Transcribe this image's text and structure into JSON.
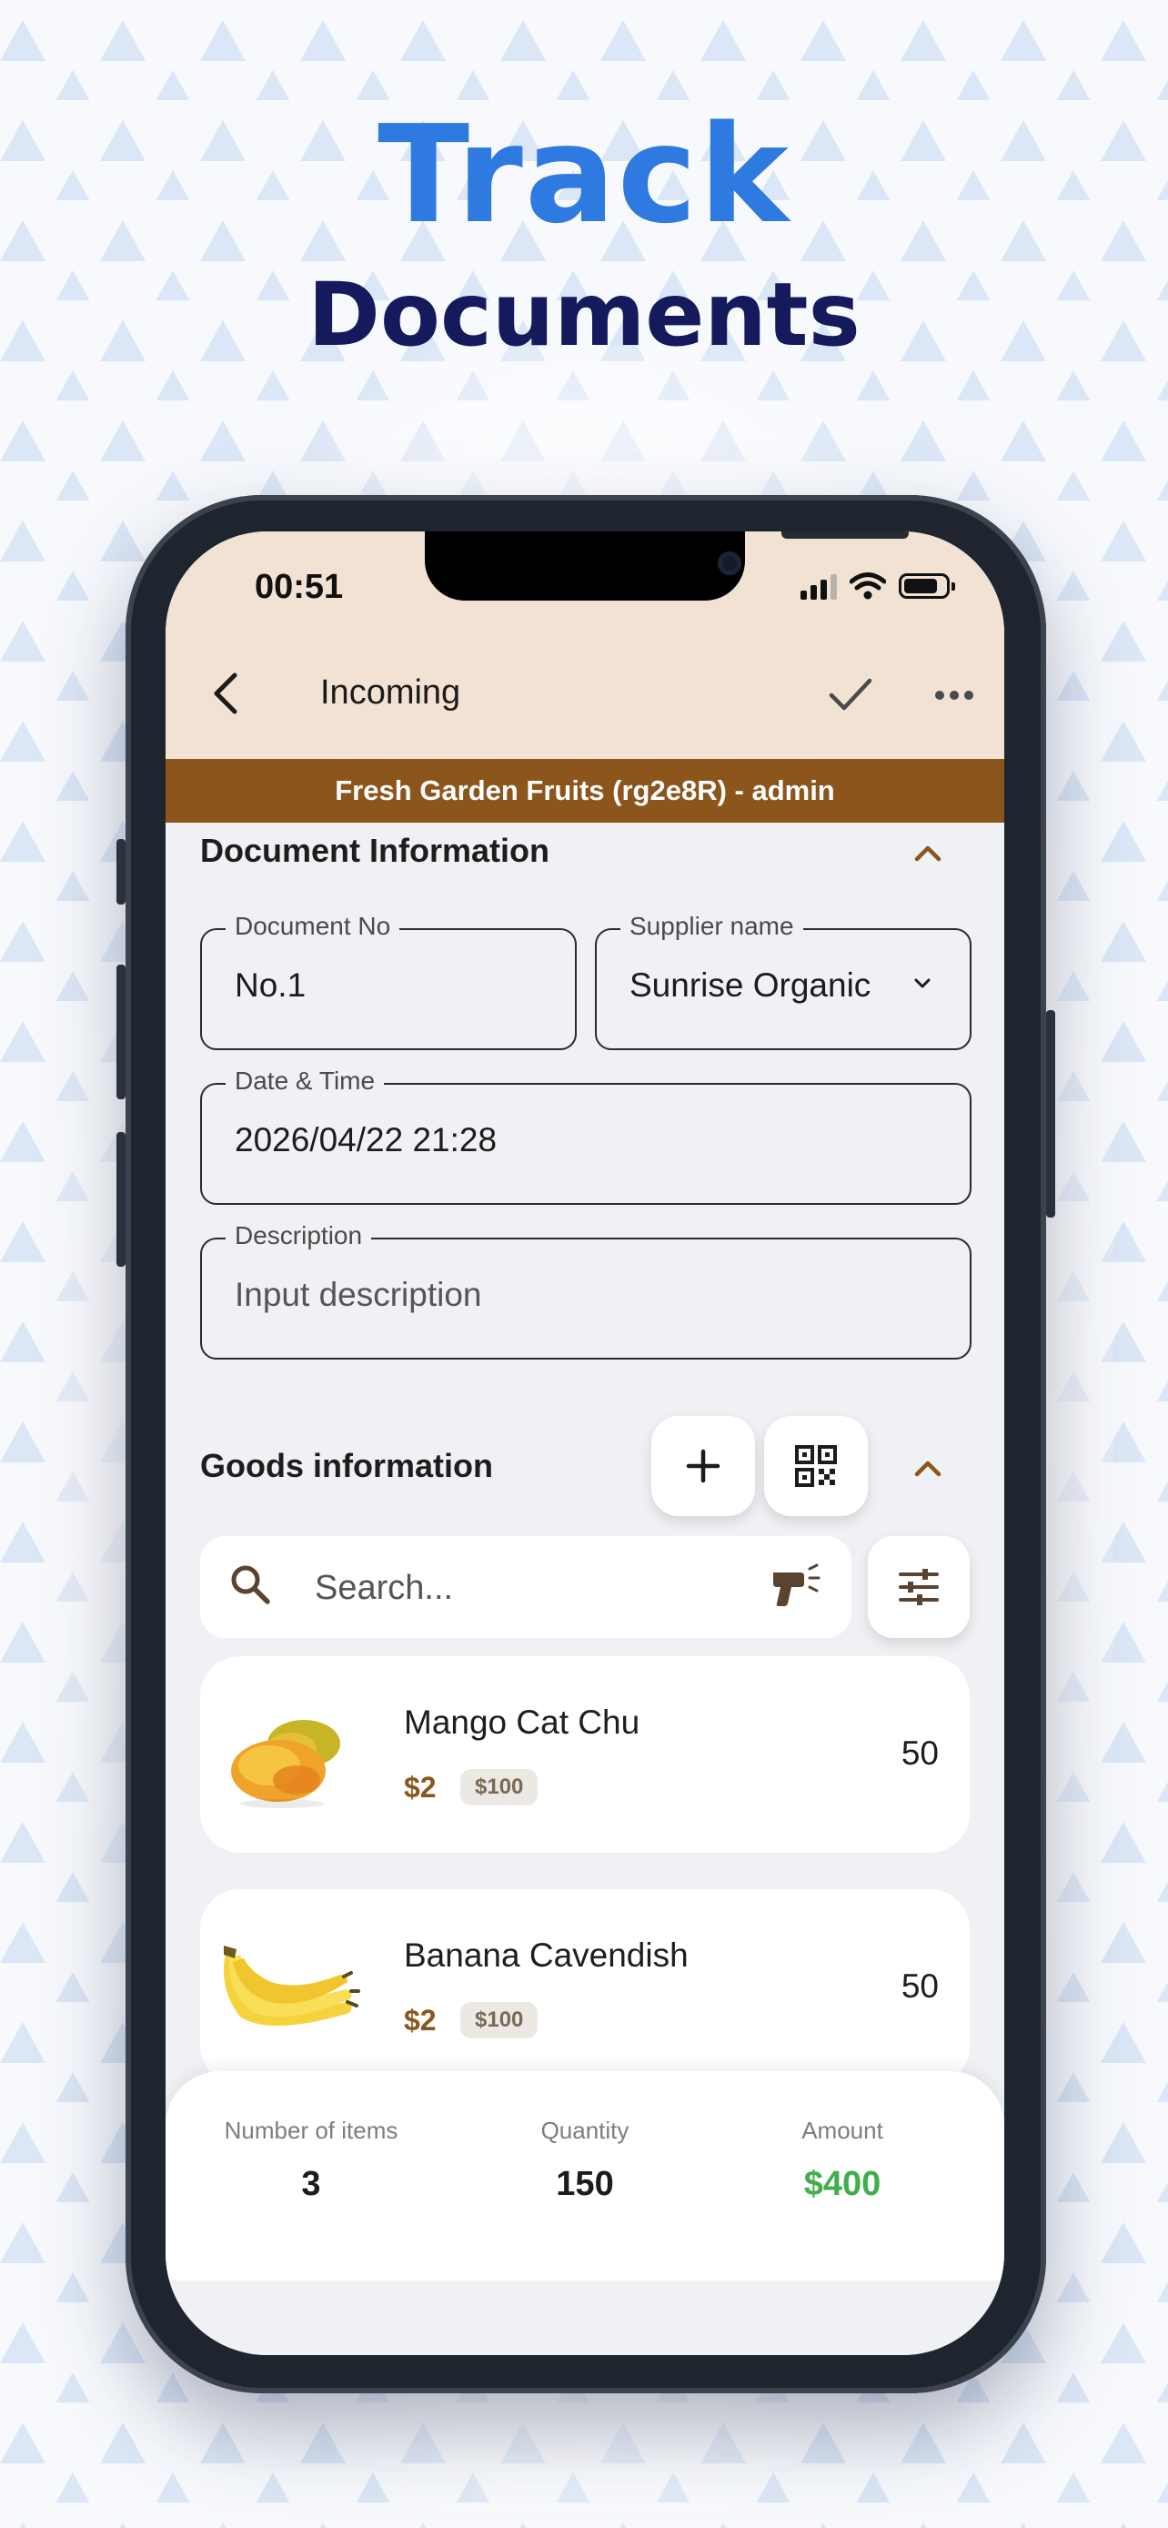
{
  "promo": {
    "headline_1": "Track",
    "headline_2": "Documents"
  },
  "status_bar": {
    "time": "00:51"
  },
  "nav": {
    "title": "Incoming",
    "back_icon": "chevron-left-icon",
    "confirm_icon": "check-icon",
    "more_icon": "more-horizontal-icon"
  },
  "banner": {
    "text": "Fresh Garden Fruits (rg2e8R) - admin"
  },
  "document_info": {
    "heading": "Document Information",
    "document_no": {
      "label": "Document No",
      "value": "No.1"
    },
    "supplier": {
      "label": "Supplier name",
      "value": "Sunrise Organic"
    },
    "datetime": {
      "label": "Date & Time",
      "value": "2026/04/22 21:28"
    },
    "description": {
      "label": "Description",
      "placeholder": "Input description"
    }
  },
  "goods": {
    "heading": "Goods information",
    "search_placeholder": "Search...",
    "items": [
      {
        "name": "Mango Cat Chu",
        "price": "$2",
        "tag": "$100",
        "qty": "50"
      },
      {
        "name": "Banana Cavendish",
        "price": "$2",
        "tag": "$100",
        "qty": "50"
      }
    ]
  },
  "summary": {
    "items_label": "Number of items",
    "items_value": "3",
    "quantity_label": "Quantity",
    "quantity_value": "150",
    "amount_label": "Amount",
    "amount_value": "$400"
  },
  "colors": {
    "accent_brown": "#8b551c",
    "header_bg": "#f1e2d3",
    "amount_green": "#3fae4b",
    "headline_blue": "#2f7ae0",
    "headline_navy": "#151a5c"
  }
}
